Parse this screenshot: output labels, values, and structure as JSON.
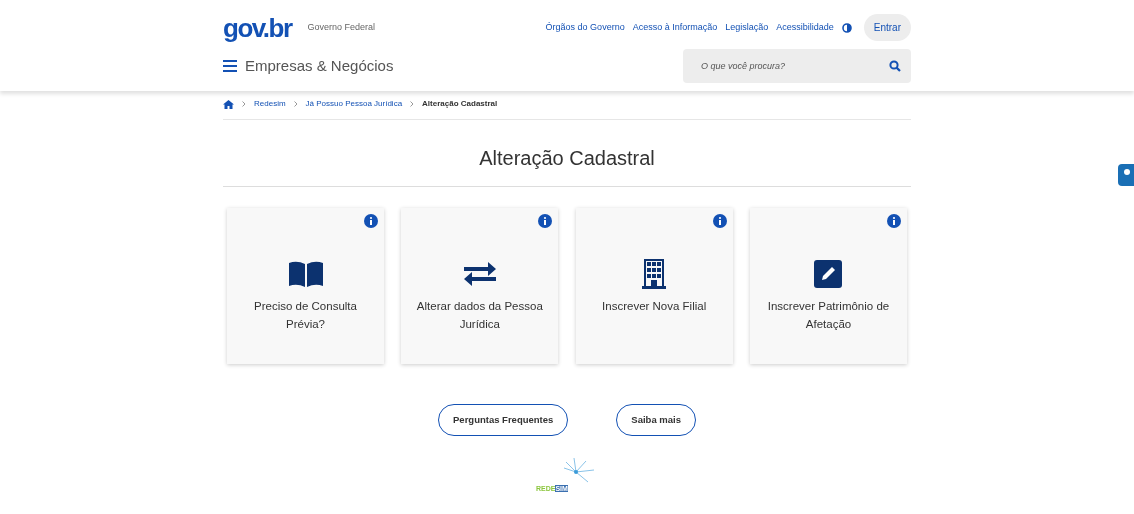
{
  "header": {
    "logo": "gov.br",
    "org": "Governo Federal",
    "links": [
      "Órgãos do Governo",
      "Acesso à Informação",
      "Legislação",
      "Acessibilidade"
    ],
    "login": "Entrar",
    "site_title": "Empresas & Negócios",
    "search": {
      "placeholder": "O que você procura?"
    }
  },
  "breadcrumb": [
    {
      "label": "Redesim",
      "current": false
    },
    {
      "label": "Já Possuo Pessoa Jurídica",
      "current": false
    },
    {
      "label": "Alteração Cadastral",
      "current": true
    }
  ],
  "title": "Alteração Cadastral",
  "cards": [
    {
      "kind": "book",
      "label": "Preciso de Consulta Prévia?"
    },
    {
      "kind": "exchange",
      "label": "Alterar dados da Pessoa Jurídica"
    },
    {
      "kind": "building",
      "label": "Inscrever Nova Filial"
    },
    {
      "kind": "edit",
      "label": "Inscrever Patrimônio de Afetação"
    }
  ],
  "buttons": [
    "Perguntas Frequentes",
    "Saiba mais"
  ],
  "footer_logo": {
    "part_1": "REDE",
    "part_2": "SIM"
  }
}
